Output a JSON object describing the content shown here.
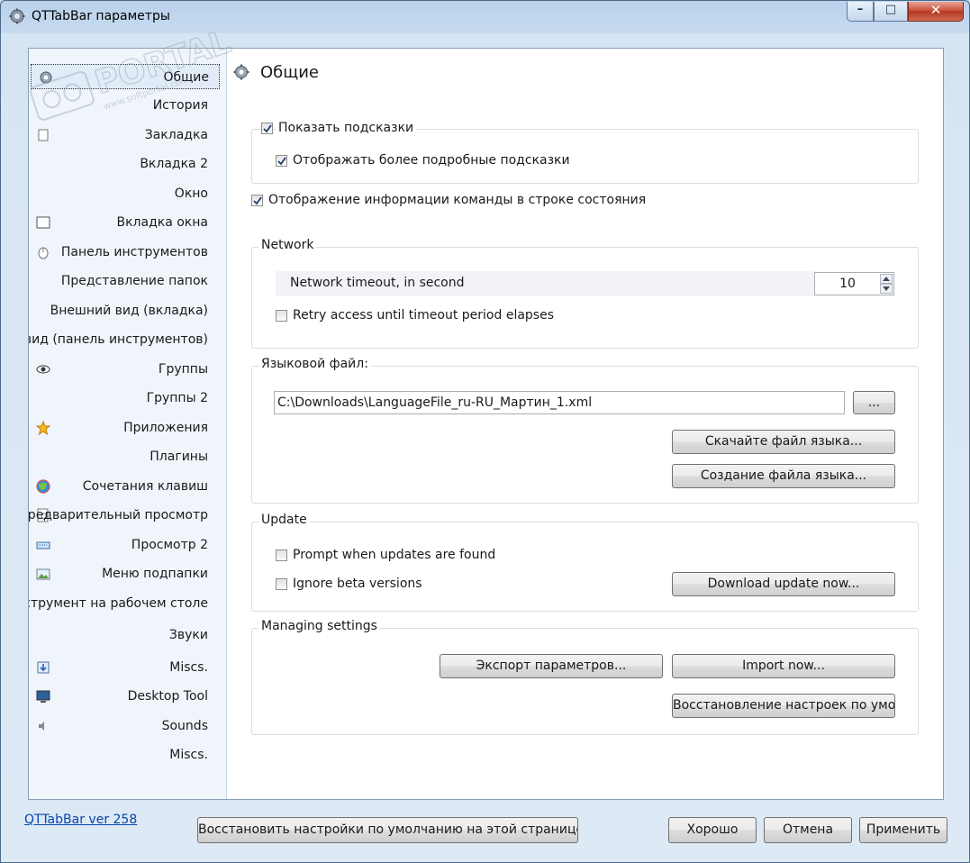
{
  "window": {
    "title": "QTTabBar параметры",
    "min_glyph": "–",
    "max_glyph": "□",
    "close_glyph": "✕"
  },
  "watermark": {
    "brand": "PORTAL",
    "tm": "TM",
    "url": "www.softportal.com"
  },
  "sidebar": {
    "items": [
      {
        "label": "Общие",
        "icon": "gear-icon",
        "selected": true
      },
      {
        "label": "История",
        "icon": ""
      },
      {
        "label": "Закладка",
        "icon": "bookmark-icon"
      },
      {
        "label": "Вкладка 2",
        "icon": ""
      },
      {
        "label": "Окно",
        "icon": ""
      },
      {
        "label": "Вкладка окна",
        "icon": "window-tab-icon"
      },
      {
        "label": "Панель инструментов",
        "icon": "mouse-icon"
      },
      {
        "label": "Представление папок",
        "icon": ""
      },
      {
        "label": "Внешний вид (вкладка)",
        "icon": ""
      },
      {
        "label": "й вид (панель инструментов)",
        "icon": ""
      },
      {
        "label": "Группы",
        "icon": "eye-icon"
      },
      {
        "label": "Группы 2",
        "icon": ""
      },
      {
        "label": "Приложения",
        "icon": "star-icon"
      },
      {
        "label": "Плагины",
        "icon": ""
      },
      {
        "label": "Сочетания клавиш",
        "icon": "globe-icon"
      },
      {
        "label": "Предварительный просмотр",
        "icon": "preview-icon"
      },
      {
        "label": "Просмотр 2",
        "icon": "keyboard-icon"
      },
      {
        "label": "Меню подпапки",
        "icon": "picture-icon"
      },
      {
        "label": "нструмент на рабочем столе",
        "icon": ""
      },
      {
        "label": "Звуки",
        "icon": ""
      },
      {
        "label": "Miscs.",
        "icon": "download-icon"
      },
      {
        "label": "Desktop Tool",
        "icon": "monitor-icon"
      },
      {
        "label": "Sounds",
        "icon": "speaker-icon"
      },
      {
        "label": "Miscs.",
        "icon": ""
      }
    ]
  },
  "page": {
    "title": "Общие",
    "show_tooltips": {
      "label": "Показать подсказки",
      "checked": true
    },
    "detailed_tooltips": {
      "label": "Отображать более подробные подсказки",
      "checked": true
    },
    "status_info": {
      "label": "Отображение информации команды в строке состояния",
      "checked": true
    },
    "network": {
      "title": "Network",
      "timeout_label": "Network timeout, in second",
      "timeout_value": "10",
      "retry": {
        "label": "Retry access until timeout period elapses",
        "checked": false
      }
    },
    "language": {
      "title": "Языковой файл:",
      "path": "C:\\Downloads\\LanguageFile_ru-RU_Мартин_1.xml",
      "browse_label": "...",
      "download_label": "Скачайте файл языка...",
      "create_label": "Создание файла языка..."
    },
    "update": {
      "title": "Update",
      "prompt": {
        "label": "Prompt when updates are found",
        "checked": false
      },
      "ignore_beta": {
        "label": "Ignore beta versions",
        "checked": false
      },
      "download_label": "Download update now..."
    },
    "managing": {
      "title": "Managing settings",
      "export_label": "Экспорт параметров...",
      "import_label": "Import now...",
      "restore_label": "Восстановление настроек по умо"
    }
  },
  "footer": {
    "version_link": "QTTabBar ver 258",
    "restore_page_label": "Восстановить настройки по умолчанию на этой странице",
    "ok_label": "Хорошо",
    "cancel_label": "Отмена",
    "apply_label": "Применить"
  }
}
